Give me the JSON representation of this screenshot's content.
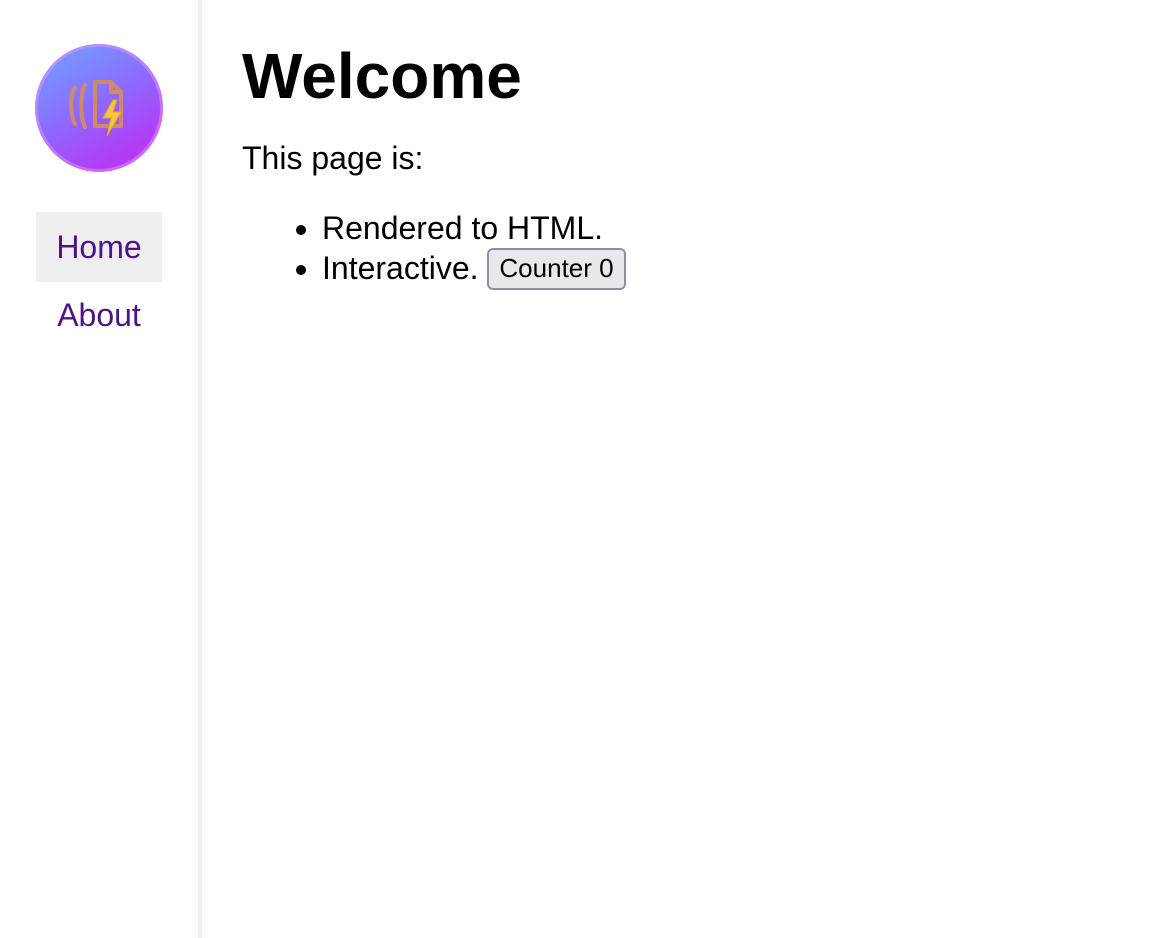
{
  "sidebar": {
    "logo_icon": "document-lightning-icon",
    "nav": [
      {
        "label": "Home",
        "active": true
      },
      {
        "label": "About",
        "active": false
      }
    ]
  },
  "main": {
    "title": "Welcome",
    "intro": "This page is:",
    "features": [
      {
        "text": "Rendered to HTML."
      },
      {
        "text": "Interactive."
      }
    ],
    "counter_label": "Counter 0"
  },
  "colors": {
    "nav_link": "#4b1588",
    "active_bg": "#eeeeee",
    "divider": "#eeeeee"
  }
}
